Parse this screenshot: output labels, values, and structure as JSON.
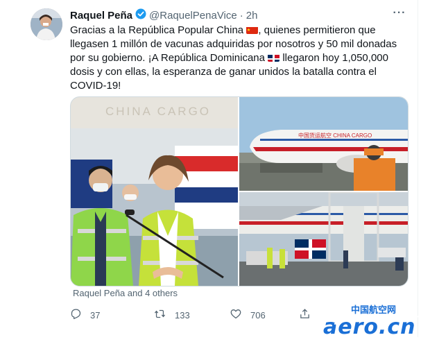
{
  "tweet": {
    "author_name": "Raquel Peña",
    "author_handle": "@RaquelPenaVice",
    "separator": "·",
    "time": "2h",
    "line1": "Gracias a la República Popular China",
    "line1b": ", quienes permitieron que llegasen 1 millón de vacunas adquiridas por nosotros y 50 mil donadas por su gobierno. ¡A República Dominicana",
    "line2": "llegaron hoy 1,050,000 dosis y con ellas, la esperanza de ganar unidos la batalla contra el COVID-19!",
    "tagged": "Raquel Peña and 4 others",
    "replies": "37",
    "retweets": "133",
    "likes": "706"
  },
  "media": {
    "left_caption": "CHINA CARGO",
    "plane_livery": "中国货运航空 CHINA CARGO"
  },
  "watermark": {
    "cn_text": "中国航空网",
    "en_text": "aero.cn"
  },
  "colors": {
    "accent": "#1d9bf0",
    "text_secondary": "#536471",
    "watermark_blue": "#1a6fd6"
  },
  "icons": [
    "verified-badge-icon",
    "more-icon",
    "person-icon",
    "reply-icon",
    "retweet-icon",
    "like-icon",
    "share-icon"
  ]
}
